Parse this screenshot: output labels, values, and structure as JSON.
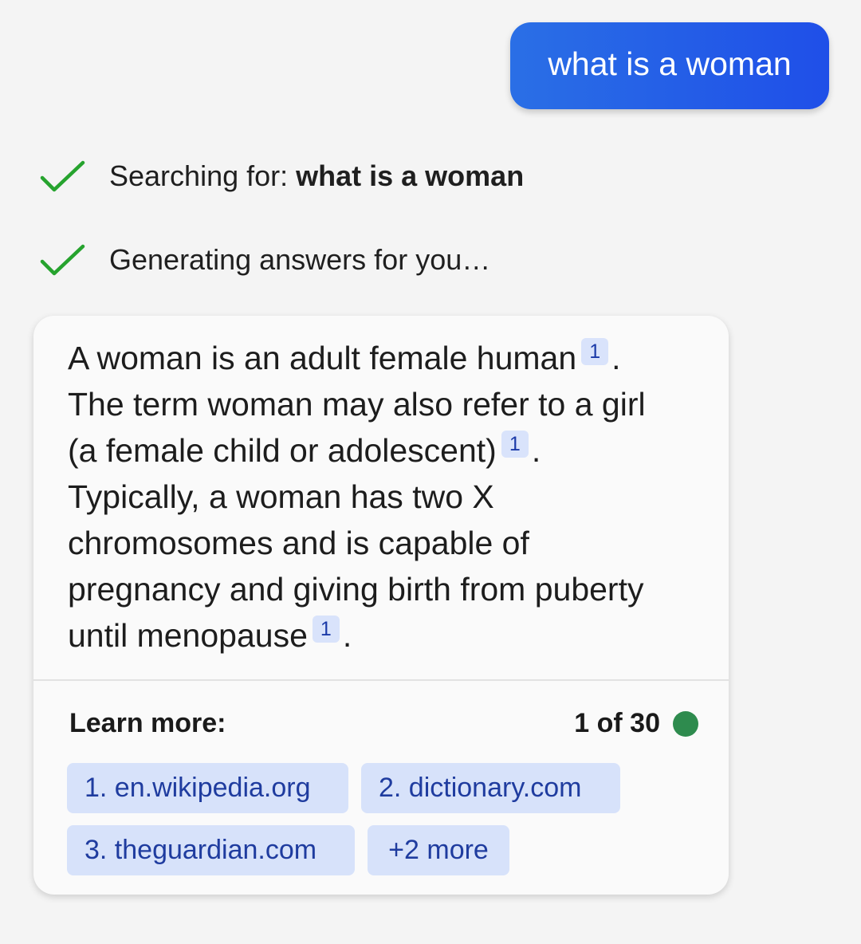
{
  "user_message": "what is a woman",
  "status": {
    "searching_label": "Searching for:",
    "searching_query": "what is a woman",
    "generating_label": "Generating answers for you…",
    "check_icon": "check-icon",
    "check_color": "#26a32e"
  },
  "answer": {
    "line1": "A woman is an adult female human",
    "line1_cite": "1",
    "line1_end": ".",
    "line2": "The term woman may also refer to a girl",
    "line3": "(a female child or adolescent)",
    "line3_cite": "1",
    "line3_end": ".",
    "line4": "Typically, a woman has two X",
    "line5": "chromosomes and is capable of",
    "line6": "pregnancy and giving birth from puberty",
    "line7": "until menopause",
    "line7_cite": "1",
    "line7_end": "."
  },
  "learn_more": {
    "title": "Learn more:",
    "counter": "1 of 30",
    "status_dot_color": "#2e8b4e",
    "links": [
      "1. en.wikipedia.org",
      "2. dictionary.com",
      "3. theguardian.com",
      "+2 more"
    ]
  }
}
